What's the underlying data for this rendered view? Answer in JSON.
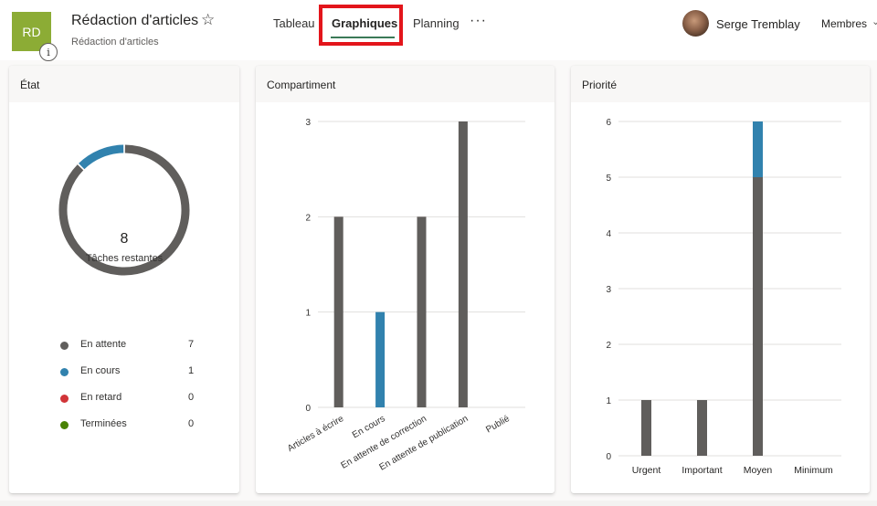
{
  "header": {
    "plan_initials": "RD",
    "plan_badge_color": "#8cac35",
    "plan_title": "Rédaction d'articles",
    "plan_subtitle": "Rédaction d'articles",
    "info_icon_glyph": "i",
    "star_icon_glyph": "☆",
    "tabs": [
      {
        "label": "Tableau",
        "active": false
      },
      {
        "label": "Graphiques",
        "active": true
      },
      {
        "label": "Planning",
        "active": false
      }
    ],
    "more_icon_glyph": "···",
    "user_name": "Serge Tremblay",
    "members_label": "Membres",
    "chevron_icon_glyph": "⌄"
  },
  "colors": {
    "not_started": "#605e5c",
    "in_progress": "#3182ae",
    "late": "#d13438",
    "completed": "#498205",
    "highlight": "#e3151b",
    "active_tab_underline": "#3b7a57"
  },
  "chart_data": [
    {
      "type": "pie",
      "title": "État",
      "center_value": "8",
      "center_label": "Tâches restantes",
      "categories": [
        "En attente",
        "En cours",
        "En retard",
        "Terminées"
      ],
      "values": [
        7,
        1,
        0,
        0
      ],
      "colors": [
        "#605e5c",
        "#3182ae",
        "#d13438",
        "#498205"
      ],
      "legend_placement": "bottom"
    },
    {
      "type": "bar",
      "title": "Compartiment",
      "categories": [
        "Articles à écrire",
        "En cours",
        "En attente de correction",
        "En attente de publication",
        "Publié"
      ],
      "series": [
        {
          "name": "En attente",
          "color": "#605e5c",
          "values": [
            2,
            0,
            2,
            3,
            0
          ]
        },
        {
          "name": "En cours",
          "color": "#3182ae",
          "values": [
            0,
            1,
            0,
            0,
            0
          ]
        }
      ],
      "stacked": true,
      "ylim": [
        0,
        3
      ],
      "yticks": [
        0,
        1,
        2,
        3
      ],
      "grid": true,
      "xlabel": "",
      "ylabel": ""
    },
    {
      "type": "bar",
      "title": "Priorité",
      "categories": [
        "Urgent",
        "Important",
        "Moyen",
        "Minimum"
      ],
      "series": [
        {
          "name": "En attente",
          "color": "#605e5c",
          "values": [
            1,
            1,
            5,
            0
          ]
        },
        {
          "name": "En cours",
          "color": "#3182ae",
          "values": [
            0,
            0,
            1,
            0
          ]
        }
      ],
      "stacked": true,
      "ylim": [
        0,
        6
      ],
      "yticks": [
        0,
        1,
        2,
        3,
        4,
        5,
        6
      ],
      "grid": true,
      "xlabel": "",
      "ylabel": ""
    }
  ]
}
